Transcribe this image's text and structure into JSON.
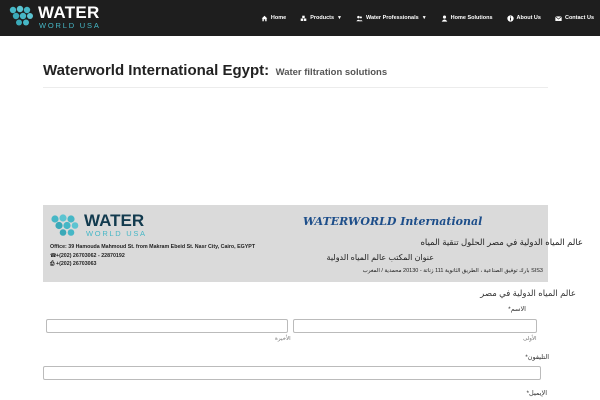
{
  "header": {
    "logo_word": "WATER",
    "logo_sub": "WORLD USA",
    "nav": [
      {
        "label": "Home",
        "icon": "home-icon"
      },
      {
        "label": "Products",
        "icon": "cubes-icon",
        "dropdown": true
      },
      {
        "label": "Water Professionals",
        "icon": "users-icon",
        "dropdown": true
      },
      {
        "label": "Home Solutions",
        "icon": "user-icon"
      },
      {
        "label": "About Us",
        "icon": "info-icon"
      },
      {
        "label": "Contact Us",
        "icon": "envelope-icon"
      }
    ]
  },
  "page": {
    "title_main": "Waterworld International Egypt:",
    "title_sub": "Water filtration solutions"
  },
  "banner": {
    "logo_word": "WATER",
    "logo_sub": "WORLD USA",
    "address": "Office: 39 Hamouda Mahmoud St. from Makram Ebeid St. Nasr City, Cairo, EGYPT",
    "phone": "+(202) 26703062 - 22870192",
    "fax": "+(202) 26703063",
    "brand_name": "WATERWORLD International",
    "arabic_line1": "عالم المياه الدولية في مصر الحلول تنقية المياه",
    "arabic_line2": "عنوان المكتب عالم المياه الدولية",
    "arabic_line3": "SIS3 بارك توفيق الصناعية ، الطريق الثانوية 111 زناتة - 20130 محمدية / المغرب"
  },
  "form": {
    "title": "عالم المياه الدولية في مصر",
    "name_label": "الاسم*",
    "first_sublabel": "الأولى",
    "last_sublabel": "الأخيرة",
    "phone_label": "التليفون*",
    "email_label": "الإيميل*"
  },
  "colors": {
    "topbar": "#1e1e1e",
    "brand_teal": "#46b7c6",
    "brand_navy": "#123a4e",
    "banner_bg": "#dadada"
  }
}
